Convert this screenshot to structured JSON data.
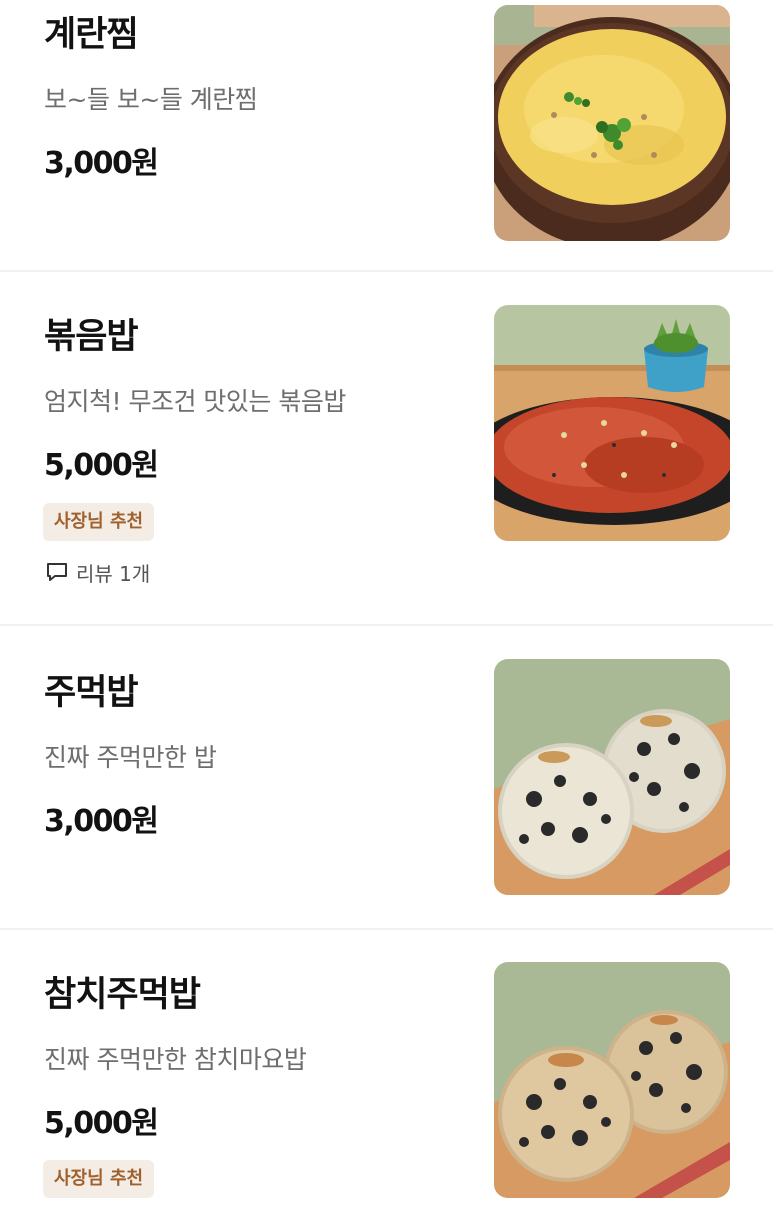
{
  "menu": {
    "items": [
      {
        "name": "계란찜",
        "description": "보~들 보~들 계란찜",
        "price": "3,000원",
        "image": "steamed-egg-photo"
      },
      {
        "name": "볶음밥",
        "description": "엄지척! 무조건 맛있는 볶음밥",
        "price": "5,000원",
        "badge": "사장님 추천",
        "review_label": "리뷰 1개",
        "review_icon": "speech-bubble-icon",
        "image": "fried-rice-photo"
      },
      {
        "name": "주먹밥",
        "description": "진짜 주먹만한 밥",
        "price": "3,000원",
        "image": "rice-ball-photo"
      },
      {
        "name": "참치주먹밥",
        "description": "진짜 주먹만한 참치마요밥",
        "price": "5,000원",
        "badge": "사장님 추천",
        "image": "tuna-rice-ball-photo"
      }
    ]
  },
  "colors": {
    "badge_background": "#f3ede6",
    "badge_text": "#a0612e",
    "divider": "#f1f1f1",
    "description_text": "#6e6e6e"
  }
}
